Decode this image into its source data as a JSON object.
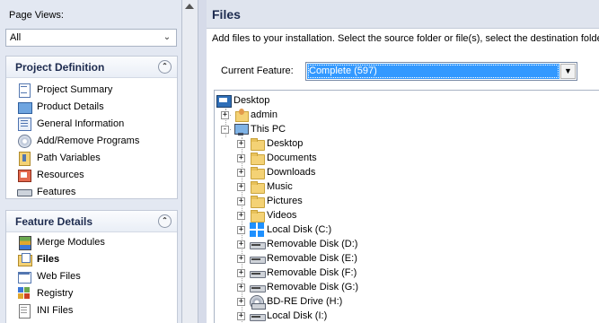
{
  "sidebar": {
    "page_views_label": "Page Views:",
    "page_views_value": "All",
    "project_definition": {
      "title": "Project Definition",
      "items": [
        {
          "label": "Project Summary",
          "icon": "project-summary-icon"
        },
        {
          "label": "Product Details",
          "icon": "product-details-icon"
        },
        {
          "label": "General Information",
          "icon": "general-information-icon"
        },
        {
          "label": "Add/Remove Programs",
          "icon": "add-remove-programs-icon"
        },
        {
          "label": "Path Variables",
          "icon": "path-variables-icon"
        },
        {
          "label": "Resources",
          "icon": "resources-icon"
        },
        {
          "label": "Features",
          "icon": "features-icon"
        }
      ]
    },
    "feature_details": {
      "title": "Feature Details",
      "items": [
        {
          "label": "Merge Modules",
          "icon": "merge-modules-icon"
        },
        {
          "label": "Files",
          "icon": "files-icon",
          "selected": true
        },
        {
          "label": "Web Files",
          "icon": "web-files-icon"
        },
        {
          "label": "Registry",
          "icon": "registry-icon"
        },
        {
          "label": "INI Files",
          "icon": "ini-files-icon"
        }
      ]
    }
  },
  "main": {
    "title": "Files",
    "instructions": "Add files to your installation. Select the source folder or file(s), select the destination folder, th",
    "current_feature_label": "Current Feature:",
    "current_feature_value": "Complete  (597)"
  },
  "tree": {
    "root": "Desktop",
    "admin": "admin",
    "this_pc": "This PC",
    "children": [
      "Desktop",
      "Documents",
      "Downloads",
      "Music",
      "Pictures",
      "Videos",
      "Local Disk (C:)",
      "Removable Disk (D:)",
      "Removable Disk (E:)",
      "Removable Disk (F:)",
      "Removable Disk (G:)",
      "BD-RE Drive (H:)",
      "Local Disk (I:)"
    ]
  },
  "colors": {
    "selection": "#3399ff",
    "header_text": "#1d2b4f"
  }
}
